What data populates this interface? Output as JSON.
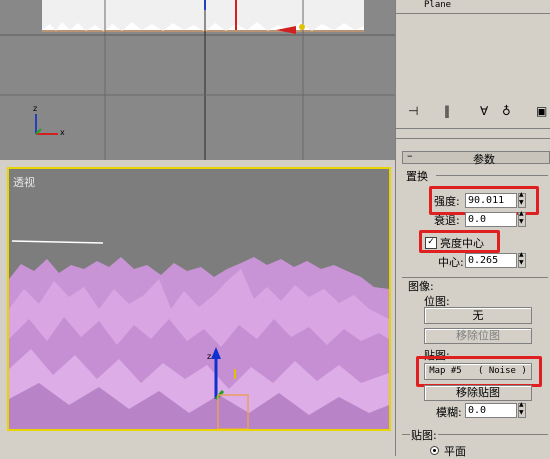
{
  "top_viewport": {
    "axis_z": "z",
    "axis_x": "x"
  },
  "persp_viewport": {
    "label": "透视",
    "axis_z": "z"
  },
  "panel": {
    "object_name": "Plane",
    "rollout_title": "参数",
    "displacement_group": "置换",
    "strength_label": "强度:",
    "strength_value": "90.011",
    "decay_label": "衰退:",
    "decay_value": "0.0",
    "luminance_center_label": "亮度中心",
    "center_label": "中心:",
    "center_value": "0.265",
    "image_group": "图像:",
    "bitmap_label": "位图:",
    "bitmap_none": "无",
    "remove_bitmap": "移除位图",
    "map_label": "贴图:",
    "map_button": "Map #5   ( Noise )",
    "remove_map": "移除贴图",
    "blur_label": "模糊:",
    "blur_value": "0.0",
    "mapping_group": "贴图:",
    "planar_label": "平面",
    "colors": {
      "highlight": "#e02020",
      "viewport_border": "#e8d400",
      "terrain": "#d9a6e3"
    }
  }
}
